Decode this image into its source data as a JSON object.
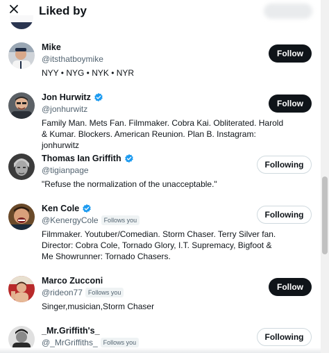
{
  "header": {
    "title": "Liked by",
    "close_icon": "close-icon"
  },
  "users": [
    {
      "name": "Mike",
      "handle": "@itsthatboymike",
      "verified": false,
      "follows_you": false,
      "bio": "NYY • NYG • NYK • NYR",
      "button": "Follow"
    },
    {
      "name": "Jon Hurwitz",
      "handle": "@jonhurwitz",
      "verified": true,
      "follows_you": false,
      "bio": "Family Man. Mets Fan. Filmmaker. Cobra Kai. Obliterated. Harold & Kumar. Blockers. American Reunion. Plan B. Instagram: jonhurwitz",
      "button": "Follow"
    },
    {
      "name": "Thomas Ian Griffith",
      "handle": "@tigianpage",
      "verified": true,
      "follows_you": false,
      "bio": "\"Refuse the normalization of the unacceptable.\"",
      "button": "Following"
    },
    {
      "name": "Ken Cole",
      "handle": "@KenergyCole",
      "verified": true,
      "follows_you": true,
      "bio": "Filmmaker. Youtuber/Comedian. Storm Chaser. Terry Silver fan. Director: Cobra Cole, Tornado Glory, I.T. Supremacy, Bigfoot & Me Showrunner: Tornado Chasers.",
      "button": "Following"
    },
    {
      "name": "Marco Zucconi",
      "handle": "@rideon77",
      "verified": false,
      "follows_you": true,
      "bio": "Singer,musician,Storm Chaser",
      "button": "Follow"
    },
    {
      "name": "_Mr.Griffith's_",
      "handle": "@_MrGriffiths_",
      "verified": false,
      "follows_you": true,
      "bio": "",
      "button": "Following"
    }
  ],
  "labels": {
    "follows_you": "Follows you"
  },
  "colors": {
    "follow_bg": "#0f1419",
    "verified": "#1d9bf0",
    "muted": "#536471"
  }
}
